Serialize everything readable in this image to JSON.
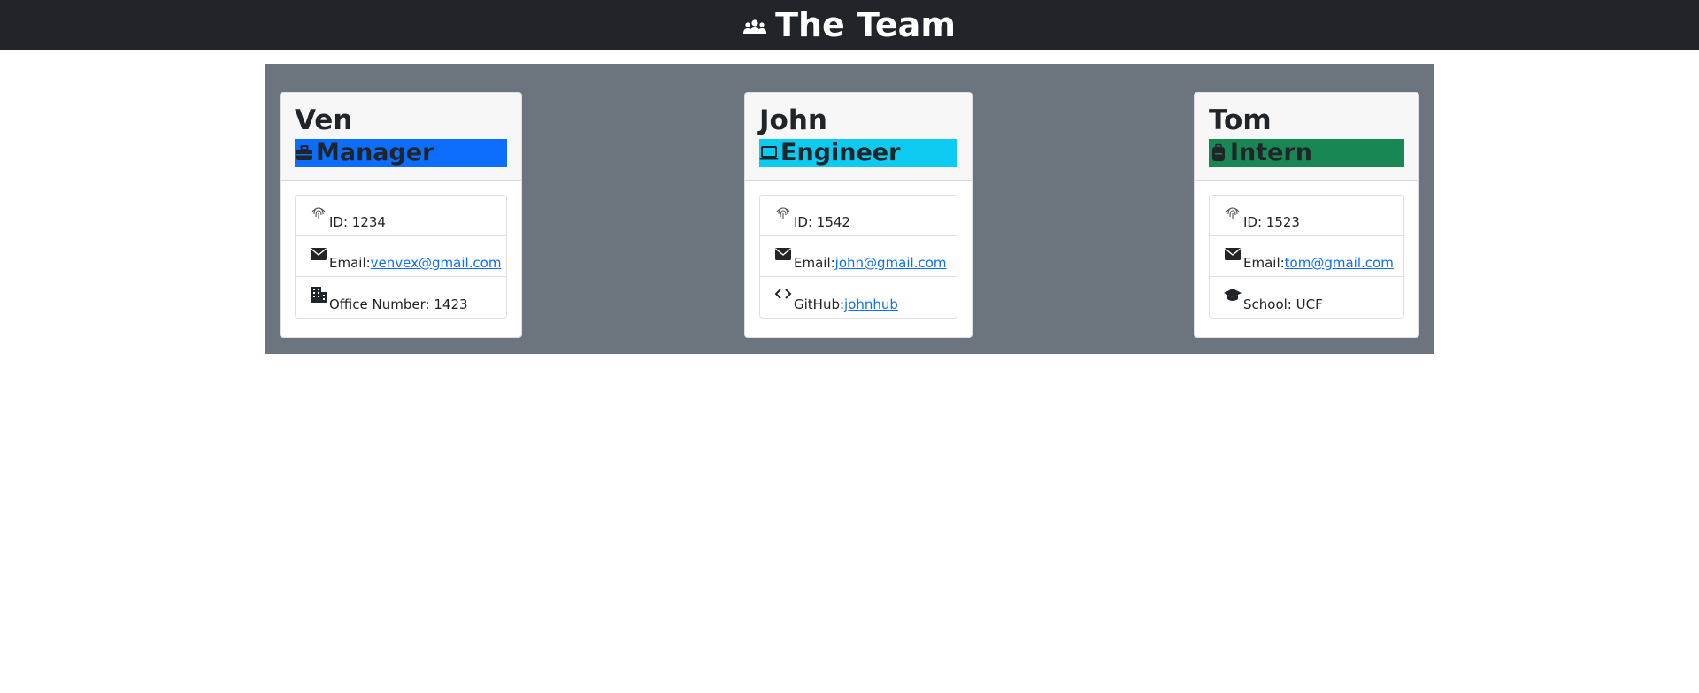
{
  "header": {
    "title": "The Team",
    "icon": "people-group-icon"
  },
  "colors": {
    "manager": "#0d6efd",
    "engineer": "#0dcaf0",
    "intern": "#198754",
    "panel": "#6c757d",
    "topbar": "#212529"
  },
  "cards": [
    {
      "name": "Ven",
      "role": "Manager",
      "role_icon": "briefcase-icon",
      "id_label": "ID: 1234",
      "email_label": "Email: ",
      "email": "venvex@gmail.com",
      "extra_label": "Office Number: 1423",
      "extra_icon": "building-icon"
    },
    {
      "name": "John",
      "role": "Engineer",
      "role_icon": "laptop-icon",
      "id_label": "ID: 1542",
      "email_label": "Email: ",
      "email": "john@gmail.com",
      "extra_label": "GitHub: ",
      "extra_link": "johnhub",
      "extra_icon": "code-icon"
    },
    {
      "name": "Tom",
      "role": "Intern",
      "role_icon": "backpack-icon",
      "id_label": "ID: 1523",
      "email_label": "Email: ",
      "email": "tom@gmail.com",
      "extra_label": "School: UCF",
      "extra_icon": "graduation-cap-icon"
    }
  ]
}
